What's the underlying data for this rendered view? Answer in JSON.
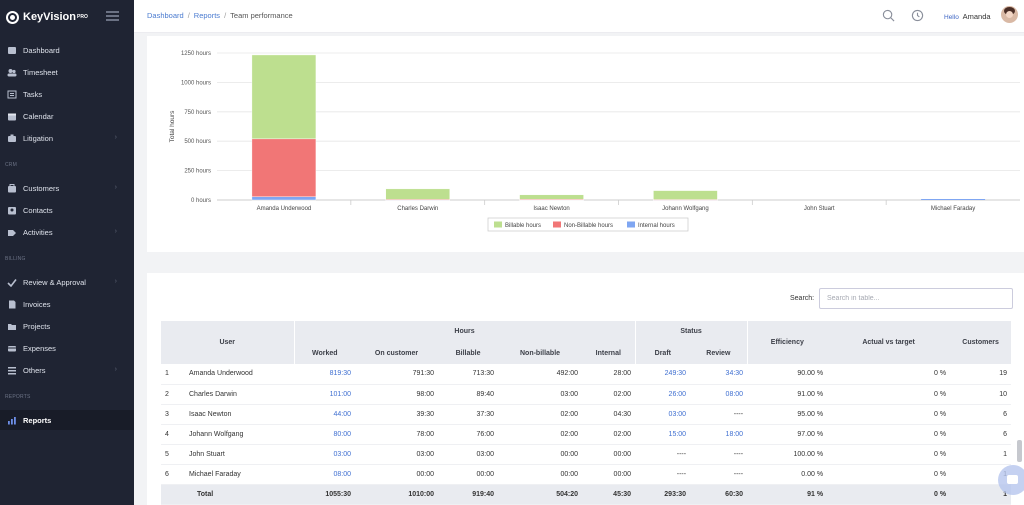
{
  "app": {
    "brand": "KeyVision",
    "brand_badge": "PRO"
  },
  "sidebar": {
    "items": [
      {
        "label": "Dashboard",
        "icon": "dashboard-icon"
      },
      {
        "label": "Timesheet",
        "icon": "users-icon"
      },
      {
        "label": "Tasks",
        "icon": "tasks-icon"
      },
      {
        "label": "Calendar",
        "icon": "calendar-icon"
      },
      {
        "label": "Litigation",
        "icon": "litigation-icon",
        "has_submenu": true
      },
      {
        "label": "Customers",
        "icon": "customers-icon",
        "has_submenu": true
      },
      {
        "label": "Contacts",
        "icon": "contacts-icon"
      },
      {
        "label": "Activities",
        "icon": "activities-icon",
        "has_submenu": true
      },
      {
        "label": "Review & Approval",
        "icon": "approval-icon",
        "has_submenu": true
      },
      {
        "label": "Invoices",
        "icon": "invoices-icon"
      },
      {
        "label": "Projects",
        "icon": "projects-icon"
      },
      {
        "label": "Expenses",
        "icon": "expenses-icon"
      },
      {
        "label": "Others",
        "icon": "others-icon",
        "has_submenu": true
      },
      {
        "label": "Reports",
        "icon": "reports-icon",
        "active": true
      }
    ],
    "sections": {
      "crm": "CRM",
      "billing": "BILLING",
      "reports": "REPORTS"
    }
  },
  "breadcrumb": {
    "dashboard": "Dashboard",
    "reports": "Reports",
    "current": "Team performance"
  },
  "header": {
    "hello": "Hello",
    "user_name": "Amanda"
  },
  "chart_data": {
    "type": "bar",
    "stacked": true,
    "categories": [
      "Amanda Underwood",
      "Charles Darwin",
      "Isaac Newton",
      "Johann Wolfgang",
      "John Stuart",
      "Michael Faraday"
    ],
    "series": [
      {
        "name": "Internal hours",
        "color": "#7fa6f2",
        "values": [
          28,
          2,
          4.5,
          2,
          0,
          0
        ]
      },
      {
        "name": "Non-Billable hours",
        "color": "#f17676",
        "values": [
          492,
          3,
          2,
          2,
          0,
          0
        ]
      },
      {
        "name": "Billable hours",
        "color": "#bddf8f",
        "values": [
          713.5,
          89.67,
          37.5,
          76,
          0,
          0
        ]
      }
    ],
    "legend_order": [
      "Billable hours",
      "Non-Billable hours",
      "Internal hours"
    ],
    "ylabel": "Total hours",
    "yticks": [
      "0 hours",
      "250 hours",
      "500 hours",
      "750 hours",
      "1000 hours",
      "1250 hours"
    ],
    "ylim": [
      0,
      1250
    ],
    "legend": "bottom-center"
  },
  "table": {
    "search_label": "Search:",
    "search_placeholder": "Search in table...",
    "headers": {
      "user": "User",
      "hours": "Hours",
      "status": "Status",
      "worked": "Worked",
      "on_customer": "On customer",
      "billable": "Billable",
      "non_billable": "Non-billable",
      "internal": "Internal",
      "draft": "Draft",
      "review": "Review",
      "efficiency": "Efficiency",
      "actual_vs_target": "Actual vs target",
      "customers": "Customers"
    },
    "rows": [
      [
        "1",
        "Amanda Underwood",
        "819:30",
        "791:30",
        "713:30",
        "492:00",
        "28:00",
        "249:30",
        "34:30",
        "90.00 %",
        "0 %",
        "19"
      ],
      [
        "2",
        "Charles Darwin",
        "101:00",
        "98:00",
        "89:40",
        "03:00",
        "02:00",
        "26:00",
        "08:00",
        "91.00 %",
        "0 %",
        "10"
      ],
      [
        "3",
        "Isaac Newton",
        "44:00",
        "39:30",
        "37:30",
        "02:00",
        "04:30",
        "03:00",
        "----",
        "95.00 %",
        "0 %",
        "6"
      ],
      [
        "4",
        "Johann Wolfgang",
        "80:00",
        "78:00",
        "76:00",
        "02:00",
        "02:00",
        "15:00",
        "18:00",
        "97.00 %",
        "0 %",
        "6"
      ],
      [
        "5",
        "John Stuart",
        "03:00",
        "03:00",
        "03:00",
        "00:00",
        "00:00",
        "----",
        "----",
        "100.00 %",
        "0 %",
        "1"
      ],
      [
        "6",
        "Michael Faraday",
        "08:00",
        "00:00",
        "00:00",
        "00:00",
        "00:00",
        "----",
        "----",
        "0.00 %",
        "0 %",
        "1"
      ]
    ],
    "totals": [
      "Total",
      "1055:30",
      "1010:00",
      "919:40",
      "504:20",
      "45:30",
      "293:30",
      "60:30",
      "91 %",
      "0 %",
      "1"
    ]
  }
}
